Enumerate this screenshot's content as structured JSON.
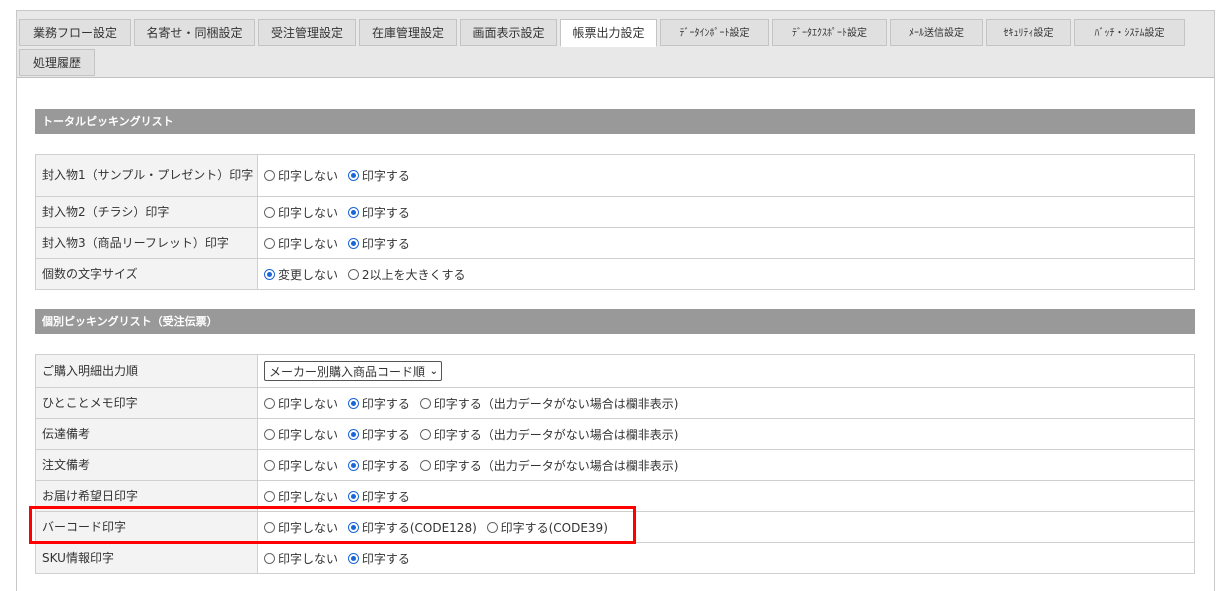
{
  "tabs": [
    {
      "label": "業務フロー設定"
    },
    {
      "label": "名寄せ・同梱設定"
    },
    {
      "label": "受注管理設定"
    },
    {
      "label": "在庫管理設定"
    },
    {
      "label": "画面表示設定"
    },
    {
      "label": "帳票出力設定"
    },
    {
      "label": "ﾃﾞｰﾀｲﾝﾎﾟｰﾄ設定"
    },
    {
      "label": "ﾃﾞｰﾀｴｸｽﾎﾟｰﾄ設定"
    },
    {
      "label": "ﾒｰﾙ送信設定"
    },
    {
      "label": "ｾｷｭﾘﾃｨ設定"
    },
    {
      "label": "ﾊﾞｯﾁ・ｼｽﾃﾑ設定"
    },
    {
      "label": "処理履歴"
    }
  ],
  "active_tab": "帳票出力設定",
  "sections": [
    {
      "title": "トータルピッキングリスト",
      "rows": [
        {
          "label": "封入物1（サンプル・プレゼント）印字",
          "options": [
            "印字しない",
            "印字する"
          ],
          "selected": 1
        },
        {
          "label": "封入物2（チラシ）印字",
          "options": [
            "印字しない",
            "印字する"
          ],
          "selected": 1
        },
        {
          "label": "封入物3（商品リーフレット）印字",
          "options": [
            "印字しない",
            "印字する"
          ],
          "selected": 1
        },
        {
          "label": "個数の文字サイズ",
          "options": [
            "変更しない",
            "2以上を大きくする"
          ],
          "selected": 0
        }
      ]
    },
    {
      "title": "個別ピッキングリスト（受注伝票）",
      "rows": [
        {
          "label": "ご購入明細出力順",
          "select_value": "メーカー別購入商品コード順"
        },
        {
          "label": "ひとことメモ印字",
          "options": [
            "印字しない",
            "印字する",
            "印字する（出力データがない場合は欄非表示)"
          ],
          "selected": 1
        },
        {
          "label": "伝達備考",
          "options": [
            "印字しない",
            "印字する",
            "印字する（出力データがない場合は欄非表示)"
          ],
          "selected": 1
        },
        {
          "label": "注文備考",
          "options": [
            "印字しない",
            "印字する",
            "印字する（出力データがない場合は欄非表示)"
          ],
          "selected": 1
        },
        {
          "label": "お届け希望日印字",
          "options": [
            "印字しない",
            "印字する"
          ],
          "selected": 1
        },
        {
          "label": "バーコード印字",
          "options": [
            "印字しない",
            "印字する(CODE128)",
            "印字する(CODE39)"
          ],
          "selected": 1
        },
        {
          "label": "SKU情報印字",
          "options": [
            "印字しない",
            "印字する"
          ],
          "selected": 1
        }
      ]
    }
  ],
  "highlight_color": "#ff0000",
  "radio_color": "#1a66d6"
}
